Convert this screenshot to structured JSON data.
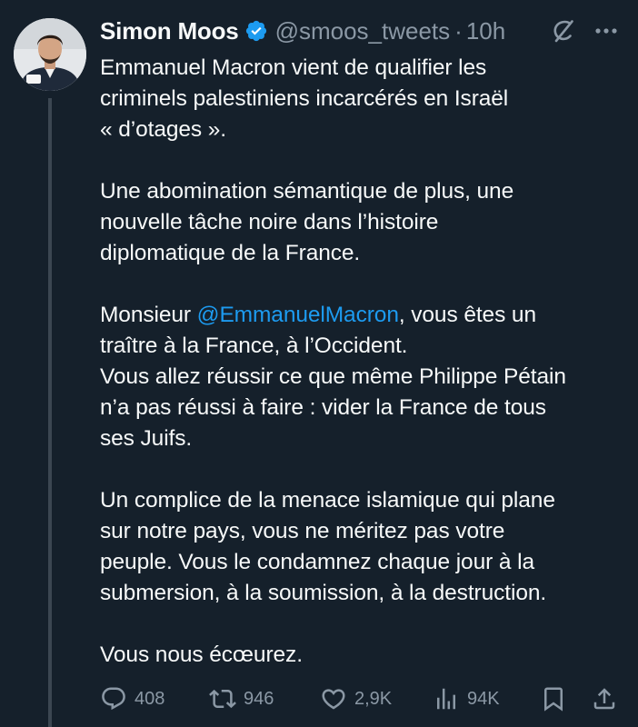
{
  "author": {
    "display_name": "Simon Moos",
    "handle": "@smoos_tweets",
    "separator": "·",
    "time": "10h",
    "verified": true
  },
  "icons": {
    "verified": "verified-badge-icon",
    "grok": "grok-icon",
    "more": "more-icon",
    "reply": "reply-icon",
    "retweet": "retweet-icon",
    "like": "like-icon",
    "views": "views-icon",
    "bookmark": "bookmark-icon",
    "share": "share-icon"
  },
  "tweet": {
    "p1_line1": "Emmanuel Macron vient de qualifier les",
    "p1_line2": "criminels palestiniens incarcérés en Israël",
    "p1_line3": "« d’otages ».",
    "p2_line1": "Une abomination sémantique de plus, une",
    "p2_line2": "nouvelle tâche noire dans l’histoire",
    "p2_line3": "diplomatique de la France.",
    "p3_line1_before": "Monsieur ",
    "p3_mention": "@EmmanuelMacron",
    "p3_line1_after": ", vous êtes un",
    "p3_line2": "traître à la France, à l’Occident.",
    "p3_line3": "Vous allez réussir ce que même Philippe Pétain",
    "p3_line4": "n’a pas réussi à faire : vider la France de tous",
    "p3_line5": "ses Juifs.",
    "p4_line1": "Un complice de la menace islamique qui plane",
    "p4_line2": "sur notre pays, vous ne méritez pas votre",
    "p4_line3": "peuple. Vous le condamnez chaque jour à la",
    "p4_line4": "submersion, à la soumission, à la destruction.",
    "p5_line1": "Vous nous écœurez."
  },
  "stats": {
    "replies": "408",
    "retweets": "946",
    "likes": "2,9K",
    "views": "94K"
  },
  "colors": {
    "background": "#15202b",
    "text": "#f7f9f9",
    "secondary": "#8b98a5",
    "accent": "#1d9bf0"
  }
}
